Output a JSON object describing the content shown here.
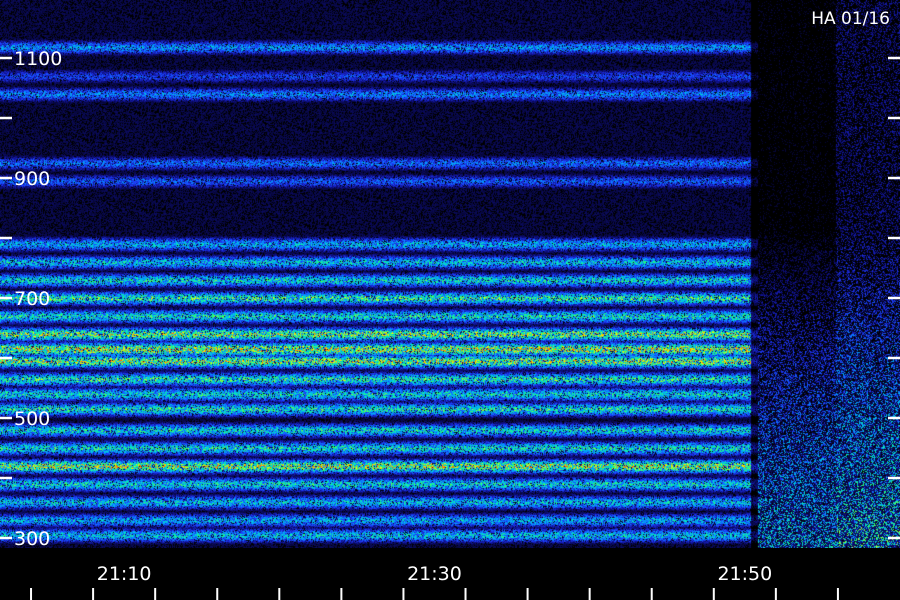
{
  "chart_data": {
    "type": "heatmap",
    "corner_label": "HA 01/16",
    "x_tick_labels": [
      "21:10",
      "21:30",
      "21:50"
    ],
    "x_tick_values_min": [
      10,
      30,
      50
    ],
    "x_range_min": [
      2,
      60
    ],
    "y_tick_labels": [
      "300",
      "500",
      "700",
      "900",
      "1100"
    ],
    "y_tick_values": [
      300,
      500,
      700,
      900,
      1100
    ],
    "y_range": [
      290,
      1100
    ],
    "colormap": [
      "#000000",
      "#10108a",
      "#1e3cff",
      "#00a0ff",
      "#00e6c8",
      "#32ff64",
      "#ffff00",
      "#ff6400"
    ],
    "dropout_from_min": 51,
    "bands": [
      {
        "y": 1118,
        "level": 0.45
      },
      {
        "y": 1070,
        "level": 0.3
      },
      {
        "y": 1040,
        "level": 0.42
      },
      {
        "y": 925,
        "level": 0.38
      },
      {
        "y": 895,
        "level": 0.35
      },
      {
        "y": 790,
        "level": 0.5
      },
      {
        "y": 760,
        "level": 0.55
      },
      {
        "y": 730,
        "level": 0.6
      },
      {
        "y": 700,
        "level": 0.68
      },
      {
        "y": 670,
        "level": 0.62
      },
      {
        "y": 640,
        "level": 0.78
      },
      {
        "y": 615,
        "level": 0.85
      },
      {
        "y": 595,
        "level": 0.8
      },
      {
        "y": 565,
        "level": 0.66
      },
      {
        "y": 540,
        "level": 0.6
      },
      {
        "y": 515,
        "level": 0.64
      },
      {
        "y": 480,
        "level": 0.6
      },
      {
        "y": 450,
        "level": 0.62
      },
      {
        "y": 420,
        "level": 0.82
      },
      {
        "y": 390,
        "level": 0.6
      },
      {
        "y": 360,
        "level": 0.55
      },
      {
        "y": 330,
        "level": 0.5
      },
      {
        "y": 305,
        "level": 0.55
      }
    ]
  }
}
